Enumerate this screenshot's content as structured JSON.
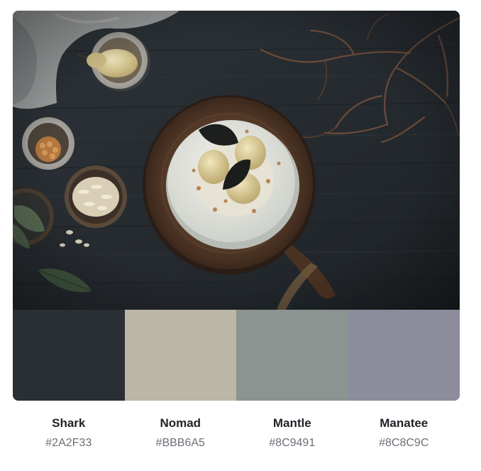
{
  "palette": {
    "colors": [
      {
        "name": "Shark",
        "hex_label": "#2A2F33",
        "hex": "#2A2F33"
      },
      {
        "name": "Nomad",
        "hex_label": "#BBB6A5",
        "hex": "#BBB6A5"
      },
      {
        "name": "Mantle",
        "hex_label": "#8C9491",
        "hex": "#8C9491"
      },
      {
        "name": "Manatee",
        "hex_label": "#8C8C9C",
        "hex": "#8C8C9C"
      }
    ]
  }
}
